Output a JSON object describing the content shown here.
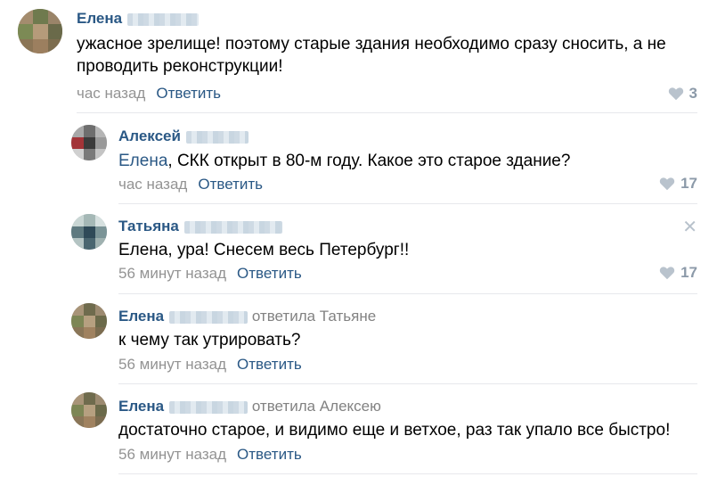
{
  "comments": [
    {
      "author": "Елена",
      "reply_to": "",
      "text": "ужасное зрелище! поэтому старые здания необходимо сразу сносить, а не проводить реконструкции!",
      "time": "час назад",
      "reply_label": "Ответить",
      "likes": "3"
    },
    {
      "author": "Алексей",
      "reply_to": "",
      "mention": "Елена",
      "text": ", СКК открыт в 80-м году. Какое это старое здание?",
      "time": "час назад",
      "reply_label": "Ответить",
      "likes": "17"
    },
    {
      "author": "Татьяна",
      "reply_to": "",
      "text": "Елена, ура! Снесем весь Петербург!!",
      "time": "56 минут назад",
      "reply_label": "Ответить",
      "likes": "17"
    },
    {
      "author": "Елена",
      "reply_to": "ответила Татьяне",
      "text": "к чему так утрировать?",
      "time": "56 минут назад",
      "reply_label": "Ответить",
      "likes": ""
    },
    {
      "author": "Елена",
      "reply_to": "ответила Алексею",
      "text": "достаточно старое, и видимо еще и ветхое, раз так упало все быстро!",
      "time": "56 минут назад",
      "reply_label": "Ответить",
      "likes": ""
    }
  ],
  "colors": {
    "link": "#2a5885",
    "meta": "#939393",
    "likes": "#8c9aa9"
  },
  "icons": {
    "like": "heart-icon",
    "close": "close-icon"
  }
}
